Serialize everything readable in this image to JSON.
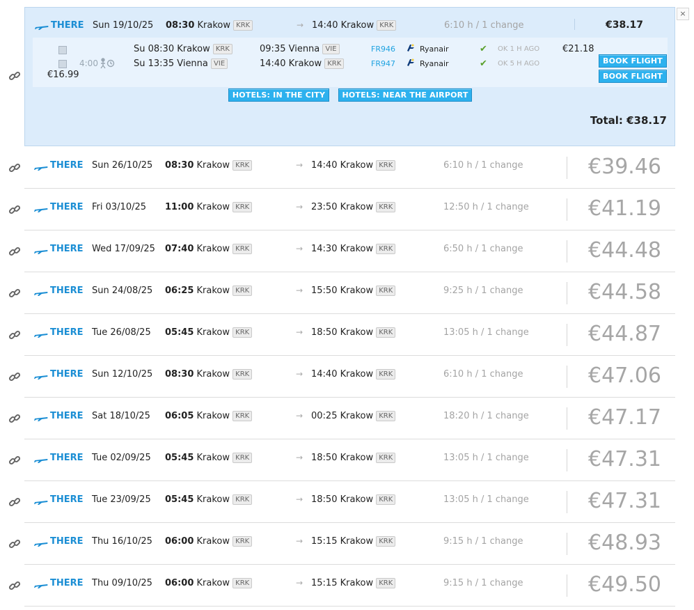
{
  "close_label": "×",
  "expanded": {
    "direction": "THERE",
    "date": "Sun 19/10/25",
    "dep_time": "08:30",
    "dep_city": "Krakow",
    "dep_code": "KRK",
    "arr_time": "14:40",
    "arr_city": "Krakow",
    "arr_code": "KRK",
    "duration": "6:10 h / 1 change",
    "price": "€38.17",
    "layover": "4:00",
    "fare_price": "€16.99",
    "legs": [
      {
        "dep": "Su 08:30 Krakow",
        "dep_code": "KRK",
        "arr": "09:35 Vienna",
        "arr_code": "VIE",
        "flight": "FR946",
        "airline": "Ryanair",
        "status": "OK 1 H AGO",
        "price": "€21.18",
        "button": "BOOK FLIGHT"
      },
      {
        "dep": "Su 13:35 Vienna",
        "dep_code": "VIE",
        "arr": "14:40 Krakow",
        "arr_code": "KRK",
        "flight": "FR947",
        "airline": "Ryanair",
        "status": "OK 5 H AGO",
        "price": "",
        "button": "BOOK FLIGHT"
      }
    ],
    "hotels_city": "HOTELS: IN THE CITY",
    "hotels_airport": "HOTELS: NEAR THE AIRPORT",
    "total": "Total: €38.17"
  },
  "rows": [
    {
      "direction": "THERE",
      "date": "Sun 26/10/25",
      "dep_time": "08:30",
      "dep_city": "Krakow",
      "dep_code": "KRK",
      "arr_time": "14:40",
      "arr_city": "Krakow",
      "arr_code": "KRK",
      "duration": "6:10 h / 1 change",
      "price": "€39.46"
    },
    {
      "direction": "THERE",
      "date": "Fri 03/10/25",
      "dep_time": "11:00",
      "dep_city": "Krakow",
      "dep_code": "KRK",
      "arr_time": "23:50",
      "arr_city": "Krakow",
      "arr_code": "KRK",
      "duration": "12:50 h / 1 change",
      "price": "€41.19"
    },
    {
      "direction": "THERE",
      "date": "Wed 17/09/25",
      "dep_time": "07:40",
      "dep_city": "Krakow",
      "dep_code": "KRK",
      "arr_time": "14:30",
      "arr_city": "Krakow",
      "arr_code": "KRK",
      "duration": "6:50 h / 1 change",
      "price": "€44.48"
    },
    {
      "direction": "THERE",
      "date": "Sun 24/08/25",
      "dep_time": "06:25",
      "dep_city": "Krakow",
      "dep_code": "KRK",
      "arr_time": "15:50",
      "arr_city": "Krakow",
      "arr_code": "KRK",
      "duration": "9:25 h / 1 change",
      "price": "€44.58"
    },
    {
      "direction": "THERE",
      "date": "Tue 26/08/25",
      "dep_time": "05:45",
      "dep_city": "Krakow",
      "dep_code": "KRK",
      "arr_time": "18:50",
      "arr_city": "Krakow",
      "arr_code": "KRK",
      "duration": "13:05 h / 1 change",
      "price": "€44.87"
    },
    {
      "direction": "THERE",
      "date": "Sun 12/10/25",
      "dep_time": "08:30",
      "dep_city": "Krakow",
      "dep_code": "KRK",
      "arr_time": "14:40",
      "arr_city": "Krakow",
      "arr_code": "KRK",
      "duration": "6:10 h / 1 change",
      "price": "€47.06"
    },
    {
      "direction": "THERE",
      "date": "Sat 18/10/25",
      "dep_time": "06:05",
      "dep_city": "Krakow",
      "dep_code": "KRK",
      "arr_time": "00:25",
      "arr_city": "Krakow",
      "arr_code": "KRK",
      "duration": "18:20 h / 1 change",
      "price": "€47.17"
    },
    {
      "direction": "THERE",
      "date": "Tue 02/09/25",
      "dep_time": "05:45",
      "dep_city": "Krakow",
      "dep_code": "KRK",
      "arr_time": "18:50",
      "arr_city": "Krakow",
      "arr_code": "KRK",
      "duration": "13:05 h / 1 change",
      "price": "€47.31"
    },
    {
      "direction": "THERE",
      "date": "Tue 23/09/25",
      "dep_time": "05:45",
      "dep_city": "Krakow",
      "dep_code": "KRK",
      "arr_time": "18:50",
      "arr_city": "Krakow",
      "arr_code": "KRK",
      "duration": "13:05 h / 1 change",
      "price": "€47.31"
    },
    {
      "direction": "THERE",
      "date": "Thu 16/10/25",
      "dep_time": "06:00",
      "dep_city": "Krakow",
      "dep_code": "KRK",
      "arr_time": "15:15",
      "arr_city": "Krakow",
      "arr_code": "KRK",
      "duration": "9:15 h / 1 change",
      "price": "€48.93"
    },
    {
      "direction": "THERE",
      "date": "Thu 09/10/25",
      "dep_time": "06:00",
      "dep_city": "Krakow",
      "dep_code": "KRK",
      "arr_time": "15:15",
      "arr_city": "Krakow",
      "arr_code": "KRK",
      "duration": "9:15 h / 1 change",
      "price": "€49.50"
    }
  ],
  "icons": {
    "link": "link-icon",
    "plane": "plane-icon",
    "arrow": "arrow-right-icon",
    "airline": "ryanair-logo-icon",
    "check": "check-icon",
    "photo": "photo-icon",
    "transfer": "self-transfer-icon"
  },
  "colors": {
    "accent": "#1b8ed4",
    "card_bg": "#dcecfb",
    "button": "#2db1ee",
    "price_gray": "#a6a6a6",
    "check": "#5aa02c"
  }
}
